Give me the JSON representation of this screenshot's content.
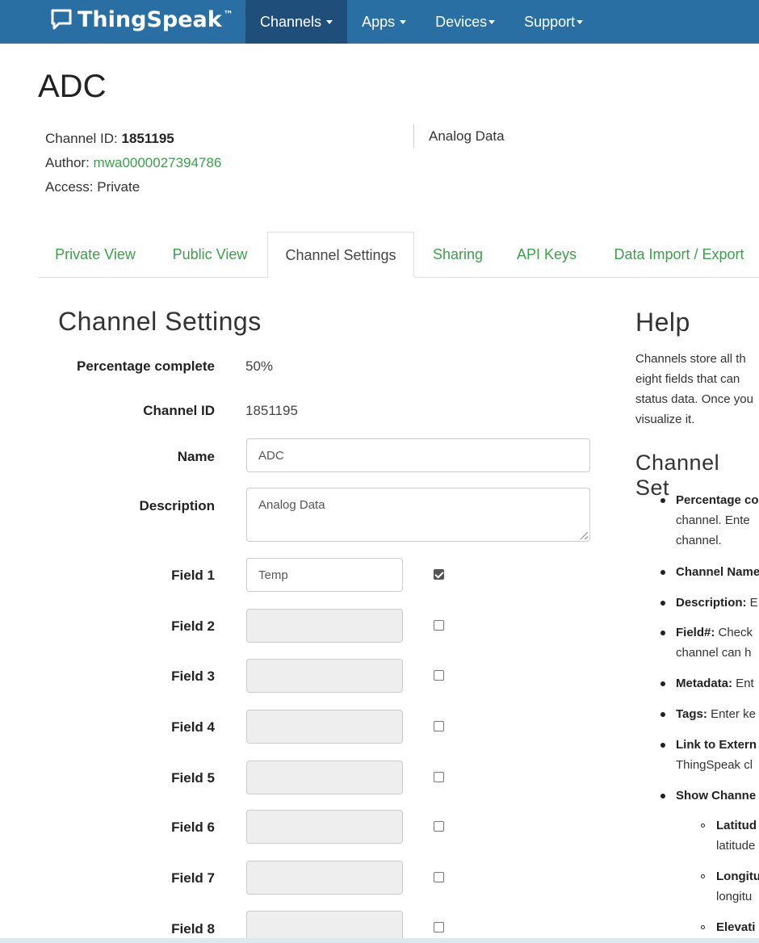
{
  "brand": {
    "name": "ThingSpeak",
    "tm": "™"
  },
  "nav": [
    {
      "label": "Channels"
    },
    {
      "label": "Apps"
    },
    {
      "label": "Devices"
    },
    {
      "label": "Support"
    }
  ],
  "channel": {
    "title": "ADC",
    "id_label": "Channel ID:",
    "id": "1851195",
    "author_label": "Author:",
    "author": "mwa0000027394786",
    "access": "Access: Private",
    "description": "Analog Data"
  },
  "tabs": [
    {
      "label": "Private View"
    },
    {
      "label": "Public View"
    },
    {
      "label": "Channel Settings"
    },
    {
      "label": "Sharing"
    },
    {
      "label": "API Keys"
    },
    {
      "label": "Data Import / Export"
    }
  ],
  "settings": {
    "heading": "Channel Settings",
    "percentage_label": "Percentage complete",
    "percentage_value": "50%",
    "channel_id_label": "Channel ID",
    "channel_id_value": "1851195",
    "name_label": "Name",
    "name_value": "ADC",
    "description_label": "Description",
    "description_value": "Analog Data",
    "fields": [
      {
        "label": "Field 1",
        "value": "Temp",
        "checked": true
      },
      {
        "label": "Field 2",
        "value": "",
        "checked": false
      },
      {
        "label": "Field 3",
        "value": "",
        "checked": false
      },
      {
        "label": "Field 4",
        "value": "",
        "checked": false
      },
      {
        "label": "Field 5",
        "value": "",
        "checked": false
      },
      {
        "label": "Field 6",
        "value": "",
        "checked": false
      },
      {
        "label": "Field 7",
        "value": "",
        "checked": false
      },
      {
        "label": "Field 8",
        "value": "",
        "checked": false
      }
    ]
  },
  "help": {
    "heading": "Help",
    "intro": [
      "Channels store all th",
      "eight fields that can",
      "status data. Once you",
      "visualize it."
    ],
    "subheading": "Channel Set",
    "items": [
      {
        "bold": "Percentage co",
        "lines": [
          "channel. Ente",
          "channel."
        ]
      },
      {
        "bold": "Channel Name",
        "lines": []
      },
      {
        "bold": "Description:",
        "rest": " E",
        "lines": []
      },
      {
        "bold": "Field#:",
        "rest": " Check",
        "lines": [
          "channel can h"
        ]
      },
      {
        "bold": "Metadata:",
        "rest": " Ent",
        "lines": []
      },
      {
        "bold": "Tags:",
        "rest": " Enter ke",
        "lines": []
      },
      {
        "bold": "Link to Extern",
        "lines": [
          "ThingSpeak cl"
        ]
      },
      {
        "bold": "Show Channe",
        "lines": []
      }
    ],
    "subitems": [
      {
        "bold": "Latitud",
        "lines": [
          "latitude"
        ]
      },
      {
        "bold": "Longitu",
        "lines": [
          "longitu"
        ]
      },
      {
        "bold": "Elevati",
        "lines": []
      }
    ]
  }
}
